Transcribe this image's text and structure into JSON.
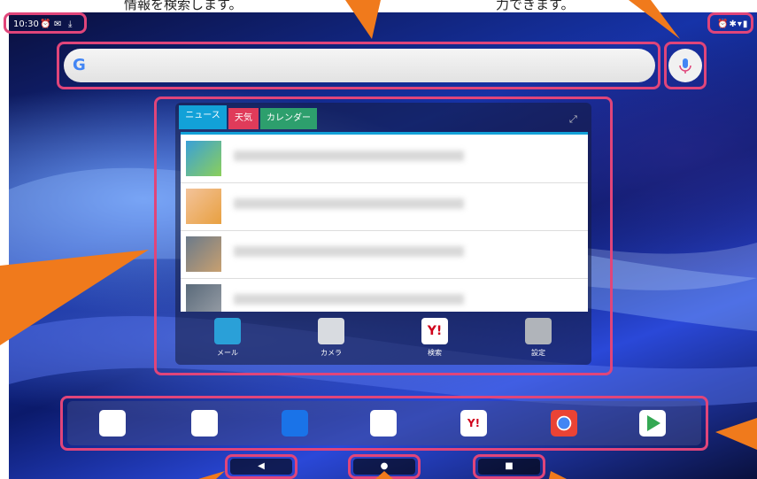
{
  "captions": {
    "left": "情報を検索します。",
    "right": "力できます。"
  },
  "status_bar": {
    "time": "10:30",
    "left_icons": [
      "alarm-icon",
      "mail-icon",
      "download-icon"
    ],
    "right_icons": [
      "alarm-icon",
      "bluetooth-icon",
      "wifi-icon",
      "battery-icon"
    ]
  },
  "search": {
    "logo": "G",
    "placeholder": ""
  },
  "widget": {
    "tabs": [
      {
        "label": "ニュース",
        "color": "#12a1d8"
      },
      {
        "label": "天気",
        "color": "#e03b5a"
      },
      {
        "label": "カレンダー",
        "color": "#2d9f6d"
      }
    ],
    "expand_icon": "⤢",
    "news": [
      {
        "headline": ""
      },
      {
        "headline": ""
      },
      {
        "headline": ""
      },
      {
        "headline": ""
      }
    ],
    "apps": [
      {
        "label": "メール",
        "icon": "mail-app-icon"
      },
      {
        "label": "カメラ",
        "icon": "camera-app-icon"
      },
      {
        "label": "検索",
        "icon": "yahoo-app-icon"
      },
      {
        "label": "設定",
        "icon": "settings-app-icon"
      }
    ]
  },
  "dock": {
    "apps": [
      "tools-folder-icon",
      "google-folder-icon",
      "duo-icon",
      "assistant-icon",
      "yahoo-icon",
      "chrome-icon",
      "play-store-icon"
    ]
  },
  "nav": {
    "back": "◀",
    "home": "●",
    "recents": "■"
  },
  "colors": {
    "highlight": "#e0457a",
    "callout": "#f07a1c"
  }
}
